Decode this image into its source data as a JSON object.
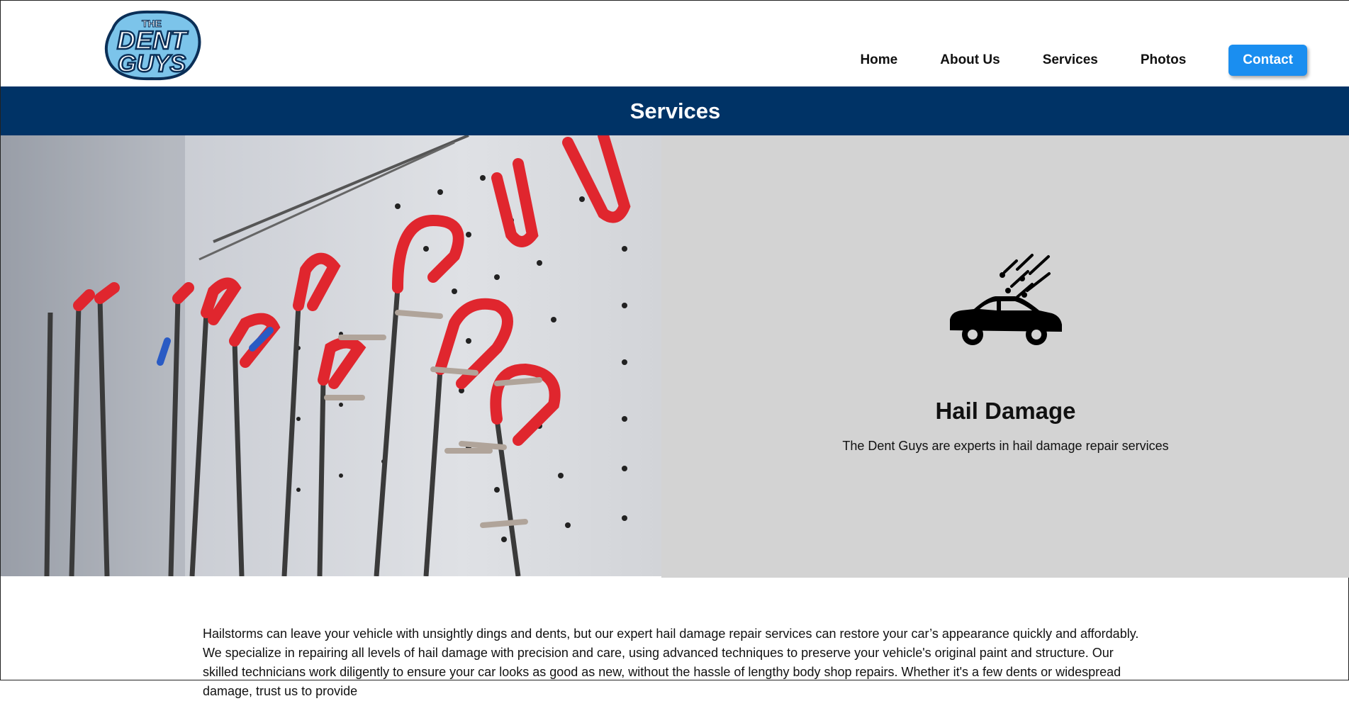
{
  "logo": {
    "line1": "THE",
    "line2": "DENT",
    "line3": "GUYS"
  },
  "nav": {
    "items": [
      {
        "label": "Home"
      },
      {
        "label": "About Us"
      },
      {
        "label": "Services"
      },
      {
        "label": "Photos"
      }
    ],
    "contact_label": "Contact"
  },
  "banner": {
    "title": "Services"
  },
  "service": {
    "icon": "car-hail-icon",
    "title": "Hail Damage",
    "description": "The Dent Guys are experts in hail damage repair services"
  },
  "body": {
    "paragraph": "Hailstorms can leave your vehicle with unsightly dings and dents, but our expert hail damage repair services can restore your car’s appearance quickly and affordably. We specialize in repairing all levels of hail damage with precision and care, using advanced techniques to preserve your vehicle's original paint and structure. Our skilled technicians work diligently to ensure your car looks as good as new, without the hassle of lengthy body shop repairs. Whether it's a few dents or widespread damage, trust us to provide"
  },
  "colors": {
    "banner_bg": "#003366",
    "contact_bg": "#1a8ef0",
    "panel_bg": "#d3d3d3",
    "tool_red": "#e0262e"
  }
}
